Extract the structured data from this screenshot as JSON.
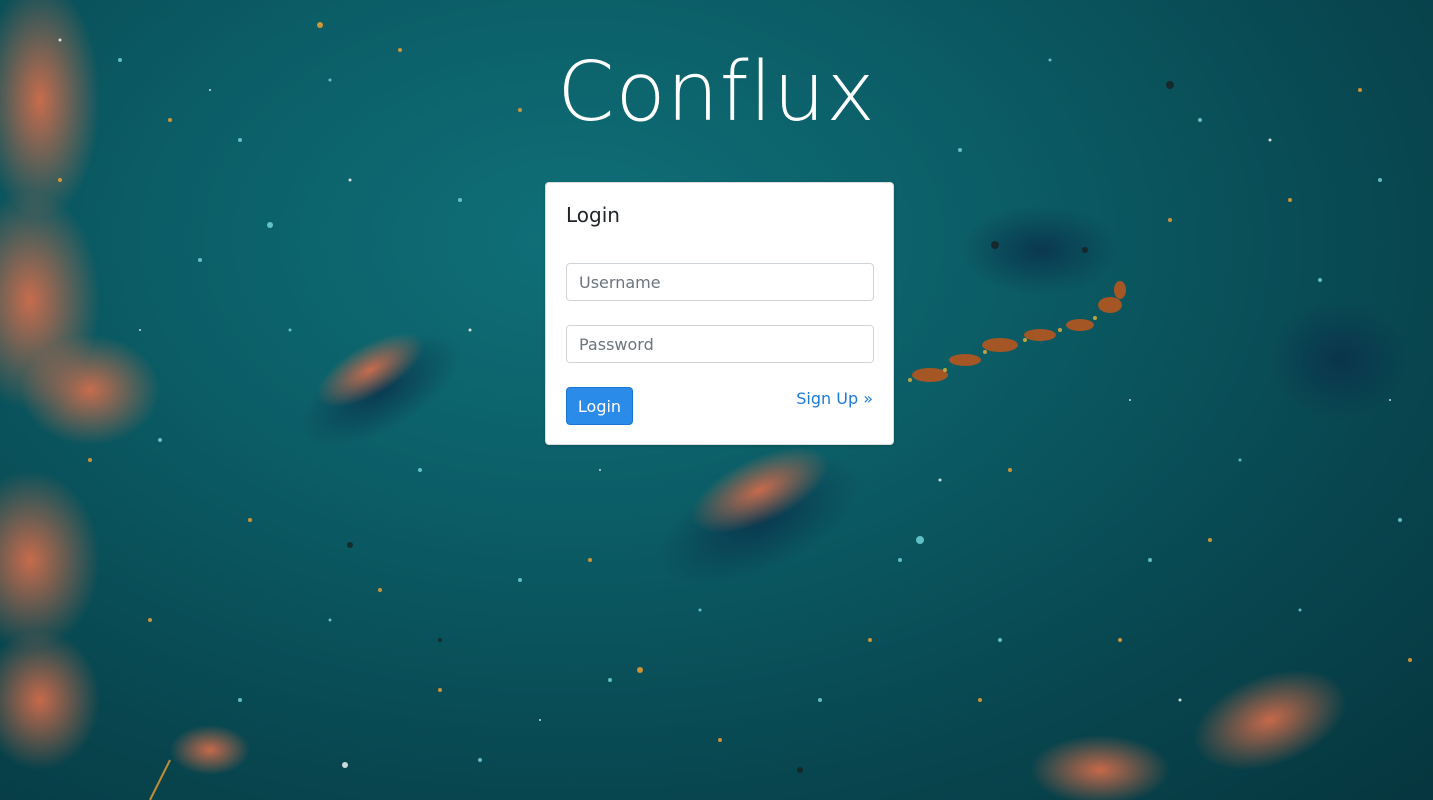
{
  "app": {
    "title": "Conflux"
  },
  "login_card": {
    "heading": "Login",
    "username_placeholder": "Username",
    "password_placeholder": "Password",
    "login_button_label": "Login",
    "signup_link_label": "Sign Up »"
  },
  "colors": {
    "primary_button": "#2a8be8",
    "link": "#1e7bd6",
    "background_base": "#0b5d66"
  }
}
